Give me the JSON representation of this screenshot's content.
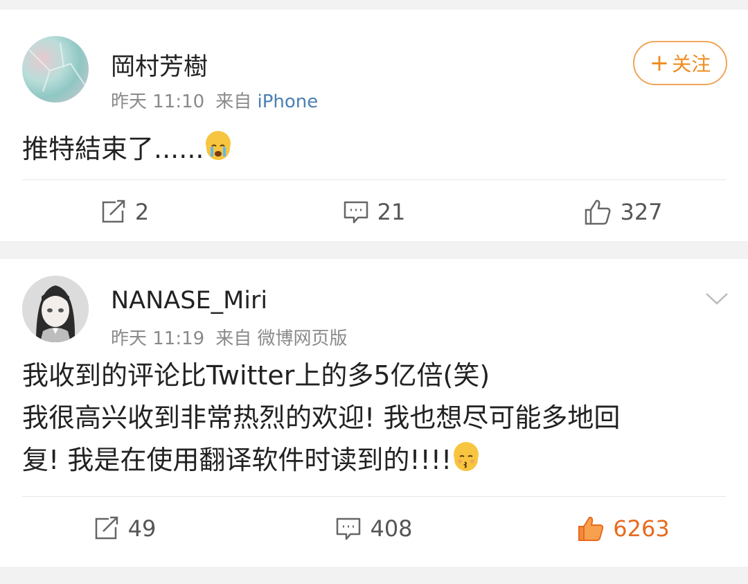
{
  "posts": [
    {
      "user_name": "岡村芳樹",
      "time": "昨天 11:10",
      "source_prefix": "来自",
      "source_device": "iPhone",
      "follow_label": "关注",
      "text_lines": [
        "推特結束了......"
      ],
      "emoji": "crying-face",
      "repost_count": "2",
      "comment_count": "21",
      "like_count": "327",
      "liked": false
    },
    {
      "user_name": "NANASE_Miri",
      "time": "昨天 11:19",
      "source_prefix": "来自",
      "source_device": "微博网页版",
      "text_lines": [
        "我收到的评论比Twitter上的多5亿倍(笑)",
        "我很高兴收到非常热烈的欢迎! 我也想尽可能多地回",
        "复! 我是在使用翻译软件时读到的!!!!"
      ],
      "emoji": "kissing-face",
      "repost_count": "49",
      "comment_count": "408",
      "like_count": "6263",
      "liked": true
    }
  ],
  "colors": {
    "accent_orange": "#f08c1e",
    "link_blue": "#4a7fb3",
    "meta_gray": "#8a8a8a",
    "liked_orange": "#e86a1e"
  }
}
